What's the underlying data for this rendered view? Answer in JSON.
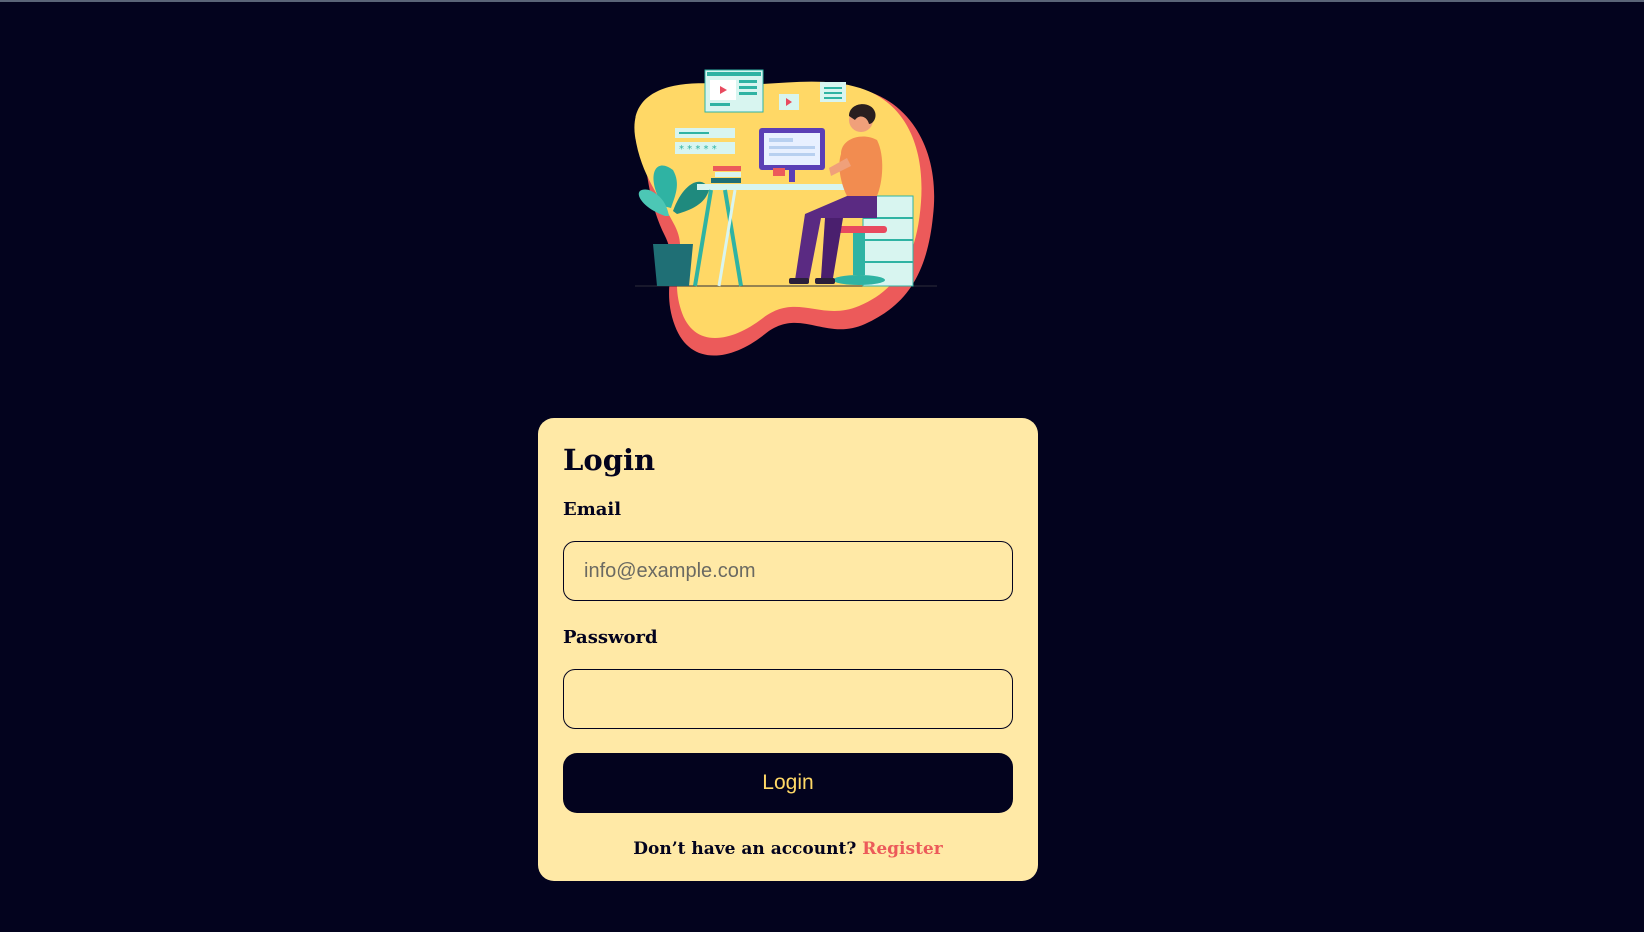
{
  "login": {
    "title": "Login",
    "email_label": "Email",
    "email_placeholder": "info@example.com",
    "email_value": "",
    "password_label": "Password",
    "password_value": "",
    "submit_label": "Login",
    "register_prompt": "Don’t have an account?",
    "register_link": "Register"
  },
  "illustration": {
    "icon": "person-at-computer-illustration"
  },
  "colors": {
    "page_background": "#03031e",
    "card_background": "#ffe9a6",
    "accent_yellow": "#ffd866",
    "accent_red": "#ec5a5a",
    "button_text": "#ffd866"
  }
}
